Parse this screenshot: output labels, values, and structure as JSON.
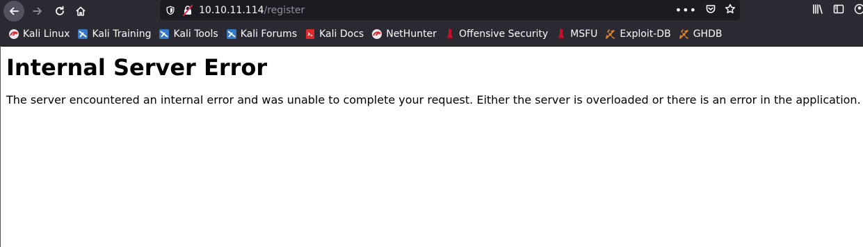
{
  "browser": {
    "url_host": "10.10.11.114",
    "url_path": "/register",
    "page_actions_glyph": "•••",
    "icons": {
      "back": "back-arrow-icon",
      "forward": "forward-arrow-icon",
      "reload": "reload-icon",
      "home": "home-icon",
      "tracking": "shield-icon",
      "insecure": "insecure-lock-icon",
      "pocket": "pocket-icon",
      "bookmark": "star-icon",
      "library": "library-icon",
      "sidebar": "sidebar-icon",
      "account": "account-icon"
    }
  },
  "bookmarks": [
    {
      "label": "Kali Linux",
      "icon": "kali-dragon-icon"
    },
    {
      "label": "Kali Training",
      "icon": "kali-training-icon"
    },
    {
      "label": "Kali Tools",
      "icon": "kali-tools-icon"
    },
    {
      "label": "Kali Forums",
      "icon": "kali-forums-icon"
    },
    {
      "label": "Kali Docs",
      "icon": "kali-docs-icon"
    },
    {
      "label": "NetHunter",
      "icon": "nethunter-icon"
    },
    {
      "label": "Offensive Security",
      "icon": "offsec-icon"
    },
    {
      "label": "MSFU",
      "icon": "msfu-icon"
    },
    {
      "label": "Exploit-DB",
      "icon": "exploitdb-icon"
    },
    {
      "label": "GHDB",
      "icon": "ghdb-icon"
    }
  ],
  "page": {
    "title": "Internal Server Error",
    "message": "The server encountered an internal error and was unable to complete your request. Either the server is overloaded or there is an error in the application."
  },
  "colors": {
    "chrome_bg": "#2b2a33",
    "urlbar_bg": "#1c1b22",
    "text_light": "#fbfbfe",
    "text_dim": "#8f8f9d"
  }
}
